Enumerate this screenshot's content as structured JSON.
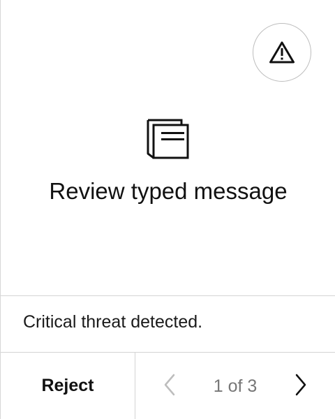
{
  "header": {
    "warning_button_icon": "warning-triangle-icon"
  },
  "main": {
    "icon": "document-stack-icon",
    "title": "Review typed message"
  },
  "status": {
    "message": "Critical threat detected."
  },
  "footer": {
    "reject_label": "Reject",
    "pager": {
      "text": "1 of 3",
      "prev_icon": "chevron-left-icon",
      "next_icon": "chevron-right-icon"
    }
  },
  "colors": {
    "text": "#111111",
    "muted_text": "#777777",
    "disabled_chevron": "#bdbdbd",
    "divider": "#d4d4d4",
    "circle_border": "#bdbdbd"
  }
}
